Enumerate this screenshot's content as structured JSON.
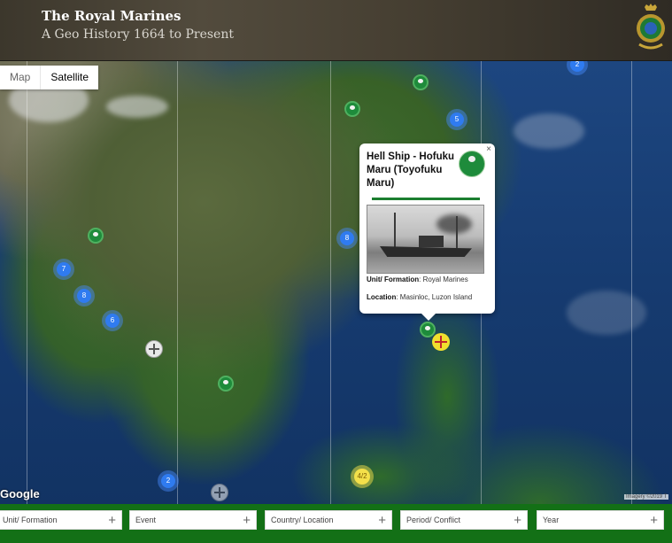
{
  "header": {
    "title": "The Royal Marines",
    "subtitle": "A Geo History 1664 to Present"
  },
  "map_controls": {
    "map_label": "Map",
    "satellite_label": "Satellite"
  },
  "clusters": [
    {
      "label": "2"
    },
    {
      "label": "5"
    },
    {
      "label": "8"
    },
    {
      "label": "7"
    },
    {
      "label": "8"
    },
    {
      "label": "6"
    },
    {
      "label": "2"
    }
  ],
  "yellow_cluster": {
    "label": "4/2"
  },
  "popup": {
    "close_label": "×",
    "title": "Hell Ship - Hofuku Maru (Toyofuku Maru)",
    "unit_label": "Unit/ Formation",
    "unit_value": "Royal Marines",
    "location_label": "Location",
    "location_value": "Masinloc, Luzon Island"
  },
  "attribution": {
    "google": "Google",
    "imagery": "Imagery ©2019 T"
  },
  "filters": [
    {
      "label": "Unit/ Formation"
    },
    {
      "label": "Event"
    },
    {
      "label": "Country/ Location"
    },
    {
      "label": "Period/ Conflict"
    },
    {
      "label": "Year"
    }
  ],
  "colors": {
    "header_bg": "#463f32",
    "filter_bar": "#137016",
    "marker_green": "#1e8b3b",
    "cluster_blue": "#2f7bf0",
    "cluster_yellow": "#f4e04a"
  }
}
